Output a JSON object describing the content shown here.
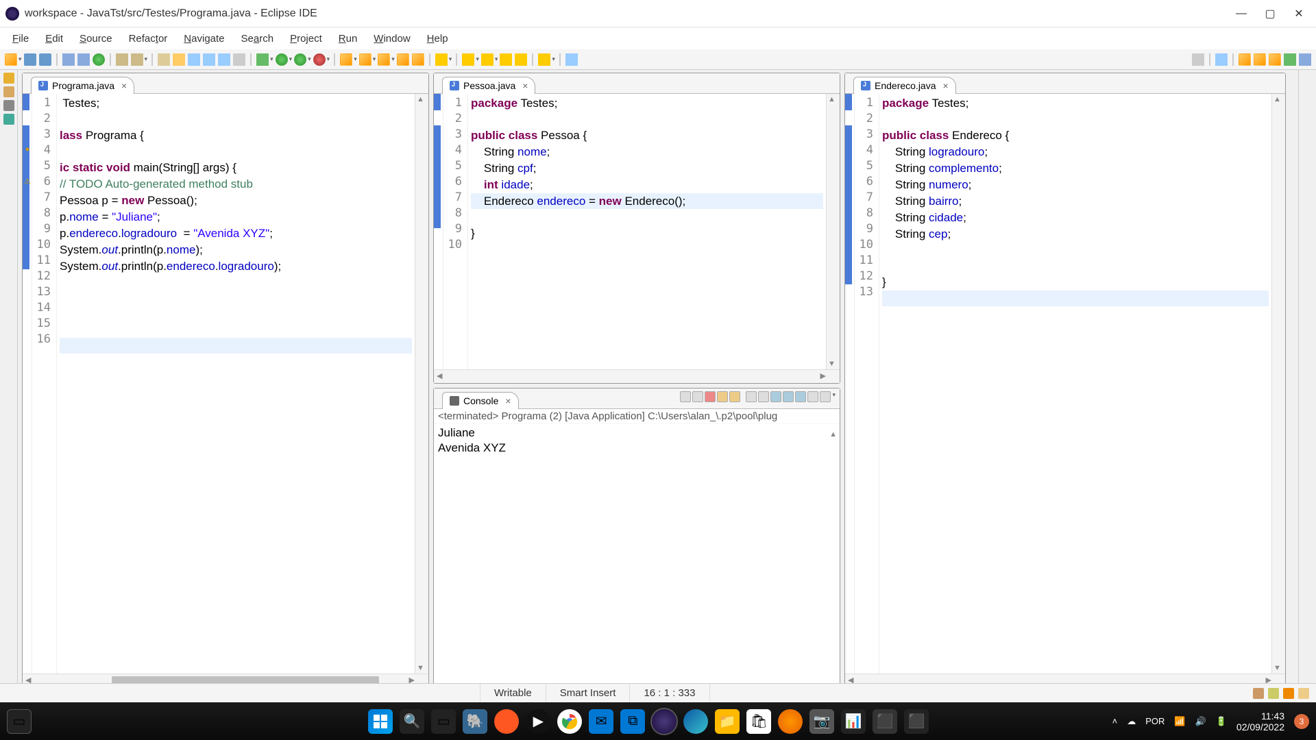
{
  "window": {
    "title": "workspace - JavaTst/src/Testes/Programa.java - Eclipse IDE"
  },
  "menu": [
    "File",
    "Edit",
    "Source",
    "Refactor",
    "Navigate",
    "Search",
    "Project",
    "Run",
    "Window",
    "Help"
  ],
  "editors": {
    "left": {
      "tab": "Programa.java",
      "lines": [
        "1",
        "2",
        "3",
        "4",
        "5",
        "6",
        "7",
        "8",
        "9",
        "10",
        "11",
        "12",
        "13",
        "14",
        "15",
        "16"
      ]
    },
    "midTop": {
      "tab": "Pessoa.java",
      "lines": [
        "1",
        "2",
        "3",
        "4",
        "5",
        "6",
        "7",
        "8",
        "9",
        "10"
      ]
    },
    "right": {
      "tab": "Endereco.java",
      "lines": [
        "1",
        "2",
        "3",
        "4",
        "5",
        "6",
        "7",
        "8",
        "9",
        "10",
        "11",
        "12",
        "13"
      ]
    }
  },
  "code": {
    "programa": {
      "l1": " Testes;",
      "l3a": "lass",
      "l3b": " Programa {",
      "l5a": "ic static void",
      "l5b": " main(String[] args) {",
      "l6": "// TODO Auto-generated method stub",
      "l7a": "Pessoa p = ",
      "l7b": "new",
      "l7c": " Pessoa();",
      "l8a": "p.",
      "l8b": "nome",
      "l8c": " = ",
      "l8d": "\"Juliane\"",
      "l8e": ";",
      "l9a": "p.",
      "l9b": "endereco",
      "l9c": ".",
      "l9d": "logradouro",
      "l9e": "  = ",
      "l9f": "\"Avenida XYZ\"",
      "l9g": ";",
      "l10a": "System.",
      "l10b": "out",
      "l10c": ".println(p.",
      "l10d": "nome",
      "l10e": ");",
      "l11a": "System.",
      "l11b": "out",
      "l11c": ".println(p.",
      "l11d": "endereco",
      "l11e": ".",
      "l11f": "logradouro",
      "l11g": ");"
    },
    "pessoa": {
      "l1a": "package",
      "l1b": " Testes;",
      "l3a": "public class",
      "l3b": " Pessoa {",
      "l4a": "    String ",
      "l4b": "nome",
      "l4c": ";",
      "l5a": "    String ",
      "l5b": "cpf",
      "l5c": ";",
      "l6a": "    ",
      "l6b": "int",
      "l6c": " ",
      "l6d": "idade",
      "l6e": ";",
      "l7a": "    Endereco ",
      "l7b": "endereco",
      "l7c": " = ",
      "l7d": "new",
      "l7e": " Endereco();",
      "l9": "}"
    },
    "endereco": {
      "l1a": "package",
      "l1b": " Testes;",
      "l3a": "public class",
      "l3b": " Endereco {",
      "l4a": "    String ",
      "l4b": "logradouro",
      "l4c": ";",
      "l5a": "    String ",
      "l5b": "complemento",
      "l5c": ";",
      "l6a": "    String ",
      "l6b": "numero",
      "l6c": ";",
      "l7a": "    String ",
      "l7b": "bairro",
      "l7c": ";",
      "l8a": "    String ",
      "l8b": "cidade",
      "l8c": ";",
      "l9a": "    String ",
      "l9b": "cep",
      "l9c": ";",
      "l12": "}"
    }
  },
  "console": {
    "tab": "Console",
    "header": "<terminated> Programa (2) [Java Application] C:\\Users\\alan_\\.p2\\pool\\plug",
    "out1": "Juliane",
    "out2": "Avenida XYZ"
  },
  "status": {
    "writable": "Writable",
    "insert": "Smart Insert",
    "pos": "16 : 1 : 333"
  },
  "tray": {
    "lang": "POR",
    "time": "11:43",
    "date": "02/09/2022",
    "notif": "3"
  }
}
